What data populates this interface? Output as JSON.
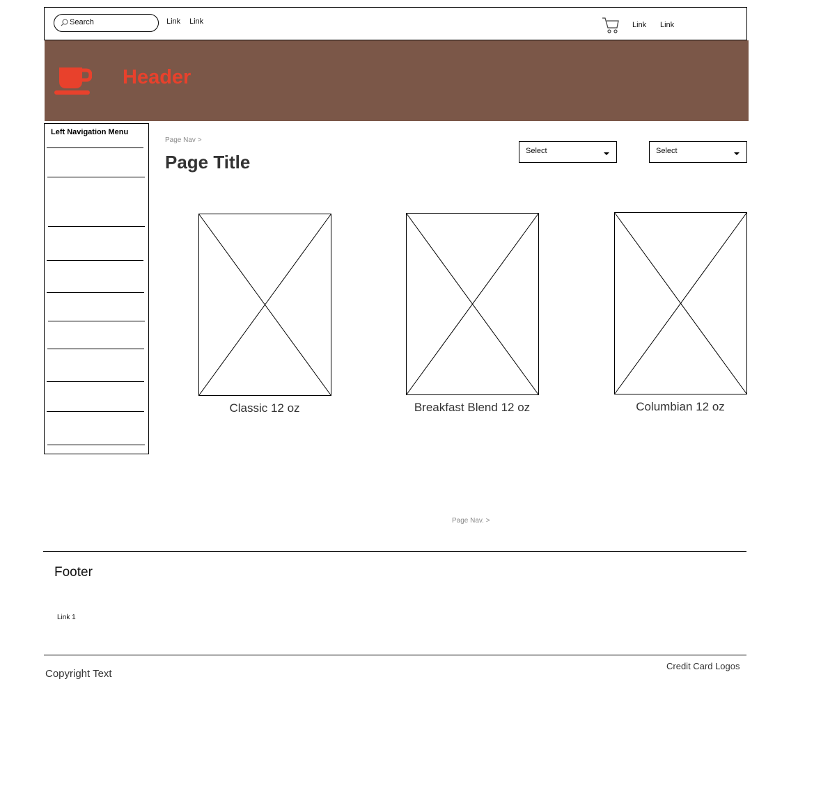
{
  "topbar": {
    "search_placeholder": "Search",
    "links_left": [
      "Link",
      "Link"
    ],
    "links_right": [
      "Link",
      "Link"
    ],
    "cart_icon": "shopping-cart-icon"
  },
  "header": {
    "title": "Header",
    "logo_icon": "coffee-cup-icon",
    "background": "#7b5748",
    "accent": "#e8412c"
  },
  "left_nav": {
    "title": "Left Navigation Menu"
  },
  "main": {
    "breadcrumb_top": "Page Nav >",
    "page_title": "Page Title",
    "selects": [
      "Select",
      "Select"
    ],
    "products": [
      {
        "name": "Classic 12 oz"
      },
      {
        "name": "Breakfast Blend 12 oz"
      },
      {
        "name": "Columbian 12 oz"
      }
    ],
    "breadcrumb_bottom": "Page Nav. >"
  },
  "footer": {
    "title": "Footer",
    "links": [
      "Link 1"
    ],
    "copyright": "Copyright Text",
    "credit_cards": "Credit Card Logos"
  }
}
